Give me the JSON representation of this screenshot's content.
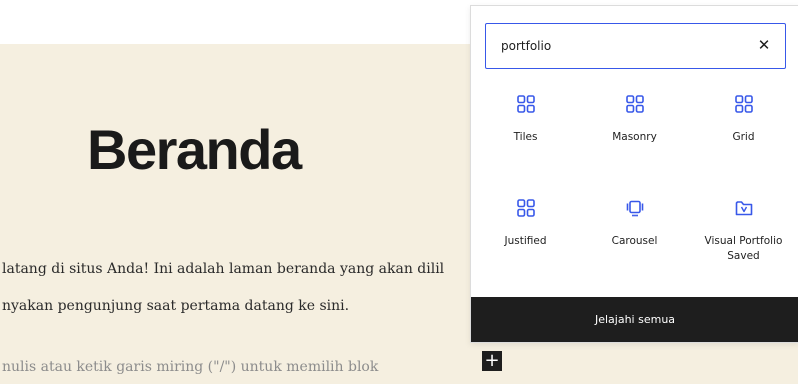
{
  "editor": {
    "title": "Beranda",
    "paragraphs": [
      "latang di situs Anda! Ini adalah laman beranda yang akan dilil",
      "nyakan pengunjung saat pertama datang ke sini."
    ],
    "placeholder": "nulis atau ketik garis miring (\"/\") untuk memilih blok",
    "add_button": "+"
  },
  "inserter": {
    "search_value": "portfolio",
    "blocks": [
      {
        "label": "Tiles",
        "icon": "grid-layout-icon"
      },
      {
        "label": "Masonry",
        "icon": "grid-layout-icon"
      },
      {
        "label": "Grid",
        "icon": "grid-layout-icon"
      },
      {
        "label": "Justified",
        "icon": "grid-layout-icon"
      },
      {
        "label": "Carousel",
        "icon": "carousel-icon"
      },
      {
        "label": "Visual Portfolio Saved",
        "icon": "saved-folder-icon"
      }
    ],
    "footer_label": "Jelajahi semua"
  },
  "colors": {
    "accent": "#3858e9",
    "canvas_bg": "#f5efe0",
    "dark": "#1e1e1e"
  }
}
